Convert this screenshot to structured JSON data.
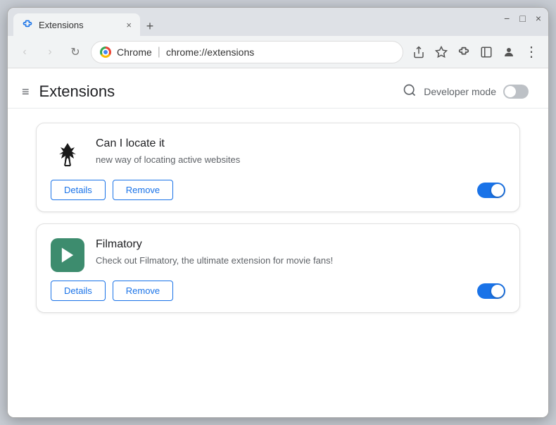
{
  "browser": {
    "tab_title": "Extensions",
    "tab_close": "×",
    "tab_new": "+",
    "window_controls": [
      "⌄",
      "−",
      "□",
      "×"
    ]
  },
  "navbar": {
    "back": "‹",
    "forward": "›",
    "refresh": "↻",
    "chrome_label": "Chrome",
    "url": "chrome://extensions",
    "separator": "|"
  },
  "page": {
    "title": "Extensions",
    "hamburger": "≡",
    "dev_mode_label": "Developer mode",
    "search_placeholder": "Search extensions"
  },
  "extensions": [
    {
      "id": "can-i-locate-it",
      "name": "Can I locate it",
      "description": "new way of locating active websites",
      "details_label": "Details",
      "remove_label": "Remove",
      "enabled": true
    },
    {
      "id": "filmatory",
      "name": "Filmatory",
      "description": "Check out Filmatory, the ultimate extension for movie fans!",
      "details_label": "Details",
      "remove_label": "Remove",
      "enabled": true
    }
  ]
}
